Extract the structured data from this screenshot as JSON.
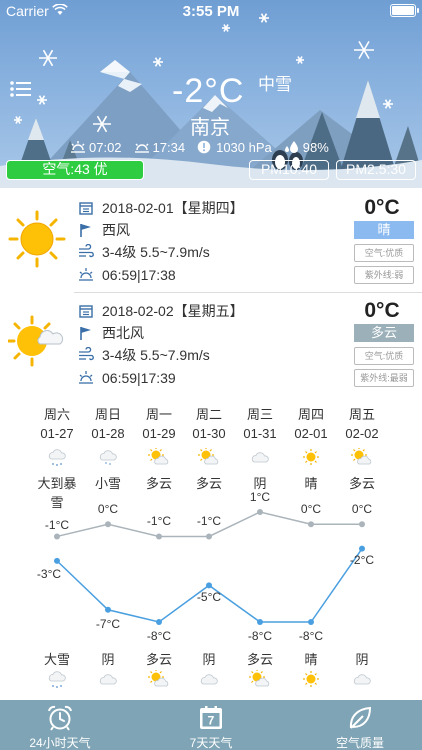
{
  "status_bar": {
    "carrier": "Carrier",
    "time": "3:55 PM"
  },
  "current": {
    "temperature": "-2°C",
    "condition": "中雪",
    "city": "南京",
    "sunrise": "07:02",
    "sunset": "17:34",
    "pressure": "1030 hPa",
    "humidity": "98%"
  },
  "air": {
    "quality": "空气:43 优",
    "pm10": "PM10:40",
    "pm25": "PM2.5:30"
  },
  "days": [
    {
      "date": "2018-02-01【星期四】",
      "wind_dir": "西风",
      "wind": "3-4级 5.5~7.9m/s",
      "sun": "06:59|17:38",
      "high": "0°C",
      "condition": "晴",
      "air": "空气:优质",
      "uv": "紫外线:弱",
      "icon": "sun-icon"
    },
    {
      "date": "2018-02-02【星期五】",
      "wind_dir": "西北风",
      "wind": "3-4级 5.5~7.9m/s",
      "sun": "06:59|17:39",
      "high": "0°C",
      "condition": "多云",
      "air": "空气:优质",
      "uv": "紫外线:最弱",
      "icon": "partly-cloudy-icon"
    }
  ],
  "week": {
    "weekdays": [
      "周六",
      "周日",
      "周一",
      "周二",
      "周三",
      "周四",
      "周五"
    ],
    "dates": [
      "01-27",
      "01-28",
      "01-29",
      "01-30",
      "01-31",
      "02-01",
      "02-02"
    ],
    "day_icons": [
      "heavy-snow-icon",
      "light-snow-icon",
      "partly-cloudy-icon",
      "partly-cloudy-icon",
      "overcast-icon",
      "sun-icon",
      "partly-cloudy-icon"
    ],
    "day_conditions": [
      "大到暴雪",
      "小雪",
      "多云",
      "多云",
      "阴",
      "晴",
      "多云"
    ],
    "night_conditions": [
      "大雪",
      "阴",
      "多云",
      "阴",
      "多云",
      "晴",
      "阴"
    ],
    "night_icons": [
      "heavy-snow-icon",
      "overcast-icon",
      "partly-cloudy-icon",
      "overcast-icon",
      "partly-cloudy-icon",
      "sun-icon",
      "overcast-icon"
    ]
  },
  "chart_data": {
    "type": "line",
    "categories": [
      "01-27",
      "01-28",
      "01-29",
      "01-30",
      "01-31",
      "02-01",
      "02-02"
    ],
    "series": [
      {
        "values": [
          -1,
          0,
          -1,
          -1,
          1,
          0,
          0
        ],
        "labels": [
          "-1°C",
          "0°C",
          "-1°C",
          "-1°C",
          "1°C",
          "0°C",
          "0°C"
        ],
        "color": "#aab4ba"
      },
      {
        "values": [
          -3,
          -7,
          -8,
          -5,
          -8,
          -8,
          -2
        ],
        "labels": [
          "-3°C",
          "-7°C",
          "-8°C",
          "-5°C",
          "-8°C",
          "-8°C",
          "-2°C"
        ],
        "color": "#4a9fe0"
      }
    ]
  },
  "tabs": [
    {
      "label": "24小时天气",
      "icon": "alarm-clock-icon"
    },
    {
      "label": "7天天气",
      "icon": "calendar-icon"
    },
    {
      "label": "空气质量",
      "icon": "leaf-icon"
    }
  ],
  "colors": {
    "header_sky": "#7aa8d9",
    "air_good": "#2ecc40",
    "tabbar": "#7fa4b5",
    "high_line": "#aab4ba",
    "low_line": "#4a9fe0",
    "sunny_pill": "#8bbaf1",
    "cloudy_pill": "#9bb0b8"
  }
}
